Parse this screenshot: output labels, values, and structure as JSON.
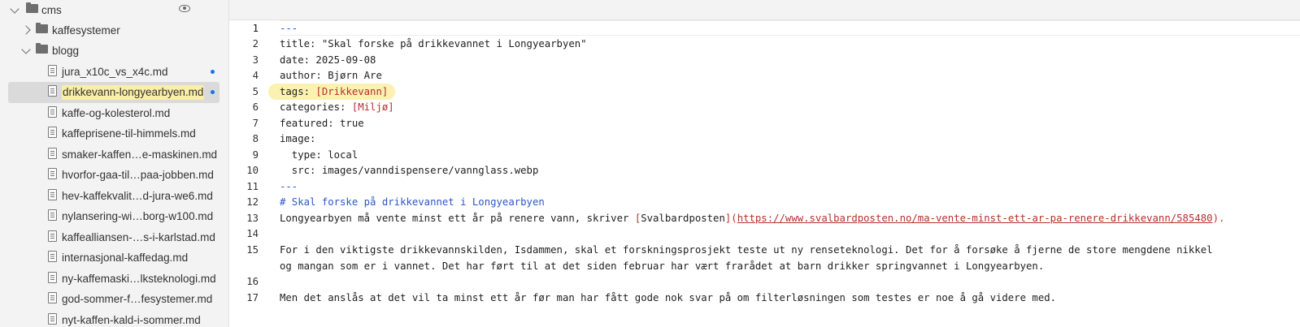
{
  "sidebar": {
    "root": {
      "label": "cms"
    },
    "folders": [
      {
        "label": "kaffesystemer",
        "expanded": false
      },
      {
        "label": "blogg",
        "expanded": true
      }
    ],
    "files": [
      {
        "label": "jura_x10c_vs_x4c.md",
        "modified": true
      },
      {
        "label": "drikkevann-longyearbyen.md",
        "modified": true,
        "selected": true
      },
      {
        "label": "kaffe-og-kolesterol.md"
      },
      {
        "label": "kaffeprisene-til-himmels.md"
      },
      {
        "label": "smaker-kaffen…e-maskinen.md"
      },
      {
        "label": "hvorfor-gaa-til…paa-jobben.md"
      },
      {
        "label": "hev-kaffekvalit…d-jura-we6.md"
      },
      {
        "label": "nylansering-wi…borg-w100.md"
      },
      {
        "label": "kaffealliansen-…s-i-karlstad.md"
      },
      {
        "label": "internasjonal-kaffedag.md"
      },
      {
        "label": "ny-kaffemaski…lksteknologi.md"
      },
      {
        "label": "god-sommer-f…fesystemer.md"
      },
      {
        "label": "nyt-kaffen-kald-i-sommer.md"
      }
    ]
  },
  "editor": {
    "line_numbers": [
      "1",
      "2",
      "3",
      "4",
      "5",
      "6",
      "7",
      "8",
      "9",
      "10",
      "11",
      "12",
      "13",
      "14",
      "15",
      "",
      "16",
      "17"
    ],
    "lines": {
      "l1": "---",
      "l2": "title: \"Skal forske på drikkevannet i Longyearbyen\"",
      "l3": "date: 2025-09-08",
      "l4": "author: Bjørn Are",
      "l5_key": "tags: ",
      "l5_val": "[Drikkevann]",
      "l6_key": "categories: ",
      "l6_val": "[Miljø]",
      "l7": "featured: true",
      "l8": "image:",
      "l9": "  type: local",
      "l10": "  src: images/vanndispensere/vannglass.webp",
      "l11": "---",
      "l12": "# Skal forske på drikkevannet i Longyearbyen",
      "l13_text": "Longyearbyen må vente minst ett år på renere vann, skriver ",
      "l13_link_open": "[",
      "l13_link_text": "Svalbardposten",
      "l13_link_close": "](",
      "l13_url": "https://www.svalbardposten.no/ma-vente-minst-ett-ar-pa-renere-drikkevann/585480",
      "l13_end": ").",
      "l14": "",
      "l15a": "For i den viktigste drikkevannskilden, Isdammen, skal et forskningsprosjekt teste ut ny renseteknologi. Det for å forsøke å fjerne de store mengdene nikkel",
      "l15b": "og mangan som er i vannet. Det har ført til at det siden februar har vært frarådet at barn drikker springvannet i Longyearbyen.",
      "l16": "",
      "l17": "Men det anslås at det vil ta minst ett år før man har fått gode nok svar på om filterløsningen som testes er noe å gå videre med."
    }
  },
  "colors": {
    "sidebar_bg": "#f3f3f3",
    "selected_row": "#dadada",
    "selected_label_highlight": "#fbeea8",
    "modified_dot": "#1a73e8",
    "frontmatter_separator": "#2850c8",
    "heading": "#2d56c4",
    "link_and_list": "#b5312c",
    "tags_line_highlight": "#fbf1b0"
  },
  "icons": [
    "chevron-down-icon",
    "chevron-right-icon",
    "folder-icon",
    "file-icon",
    "eye-icon",
    "modified-dot"
  ]
}
